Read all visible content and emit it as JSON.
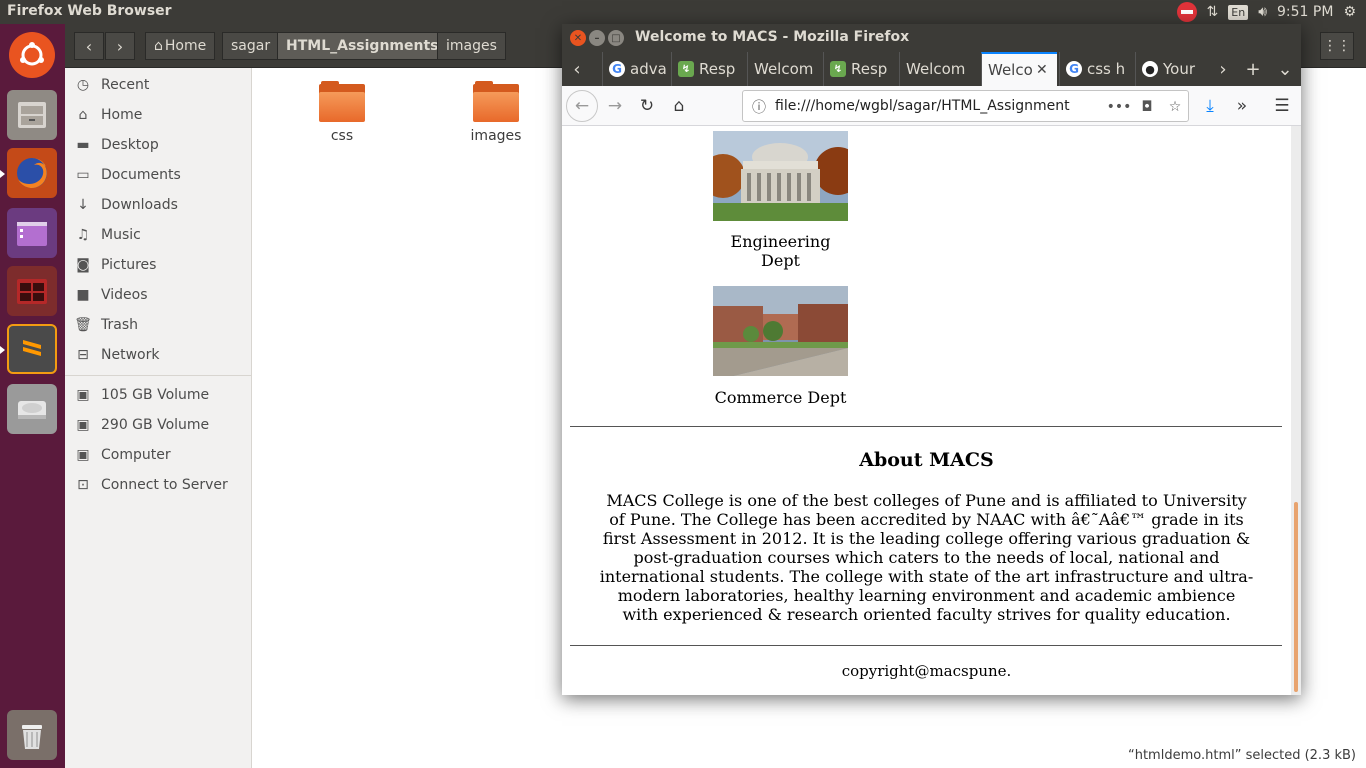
{
  "top_panel": {
    "app_title": "Firefox Web Browser",
    "keyboard": "En",
    "time": "9:51 PM"
  },
  "launcher": {
    "items": [
      "ubuntu-dash",
      "files",
      "firefox",
      "unity-tweak",
      "terminal",
      "sublime-text",
      "disks",
      "trash"
    ]
  },
  "files": {
    "breadcrumbs": [
      "Home",
      "sagar",
      "HTML_Assignments",
      "images"
    ],
    "sidebar": [
      {
        "label": "Recent",
        "icon": "clock-icon"
      },
      {
        "label": "Home",
        "icon": "home-icon"
      },
      {
        "label": "Desktop",
        "icon": "folder-icon"
      },
      {
        "label": "Documents",
        "icon": "document-icon"
      },
      {
        "label": "Downloads",
        "icon": "download-icon"
      },
      {
        "label": "Music",
        "icon": "music-icon"
      },
      {
        "label": "Pictures",
        "icon": "camera-icon"
      },
      {
        "label": "Videos",
        "icon": "video-icon"
      },
      {
        "label": "Trash",
        "icon": "trash-icon"
      },
      {
        "label": "Network",
        "icon": "network-icon"
      }
    ],
    "devices": [
      {
        "label": "105 GB Volume",
        "icon": "drive-icon"
      },
      {
        "label": "290 GB Volume",
        "icon": "drive-icon"
      },
      {
        "label": "Computer",
        "icon": "drive-icon"
      },
      {
        "label": "Connect to Server",
        "icon": "server-icon"
      }
    ],
    "folders": [
      "css",
      "images"
    ],
    "status": "“htmldemo.html” selected  (2.3 kB)"
  },
  "firefox": {
    "window_title": "Welcome to MACS - Mozilla Firefox",
    "tabs": [
      {
        "label": "adva",
        "icon": "google"
      },
      {
        "label": "Resp",
        "icon": "resp"
      },
      {
        "label": "Welcom",
        "icon": ""
      },
      {
        "label": "Resp",
        "icon": "resp"
      },
      {
        "label": "Welcom",
        "icon": ""
      },
      {
        "label": "Welco",
        "icon": "",
        "active": true
      },
      {
        "label": "css h",
        "icon": "google"
      },
      {
        "label": "Your",
        "icon": "github"
      }
    ],
    "url": "file:///home/wgbl/sagar/HTML_Assignment"
  },
  "page": {
    "depts": [
      {
        "caption_line1": "Engineering",
        "caption_line2": "Dept"
      },
      {
        "caption_line1": "Commerce Dept",
        "caption_line2": ""
      }
    ],
    "about_title": "About MACS",
    "about_text": "MACS College is one of the best colleges of Pune and is affiliated to University of Pune. The College has been accredited by NAAC with â€˜Aâ€™ grade in its first Assessment in 2012. It is the leading college offering various graduation & post-graduation courses which caters to the needs of local, national and international students. The college with state of the art infrastructure and ultra-modern laboratories, healthy learning environment and academic ambience with experienced & research oriented faculty strives for quality education.",
    "copyright": "copyright@macspune."
  }
}
